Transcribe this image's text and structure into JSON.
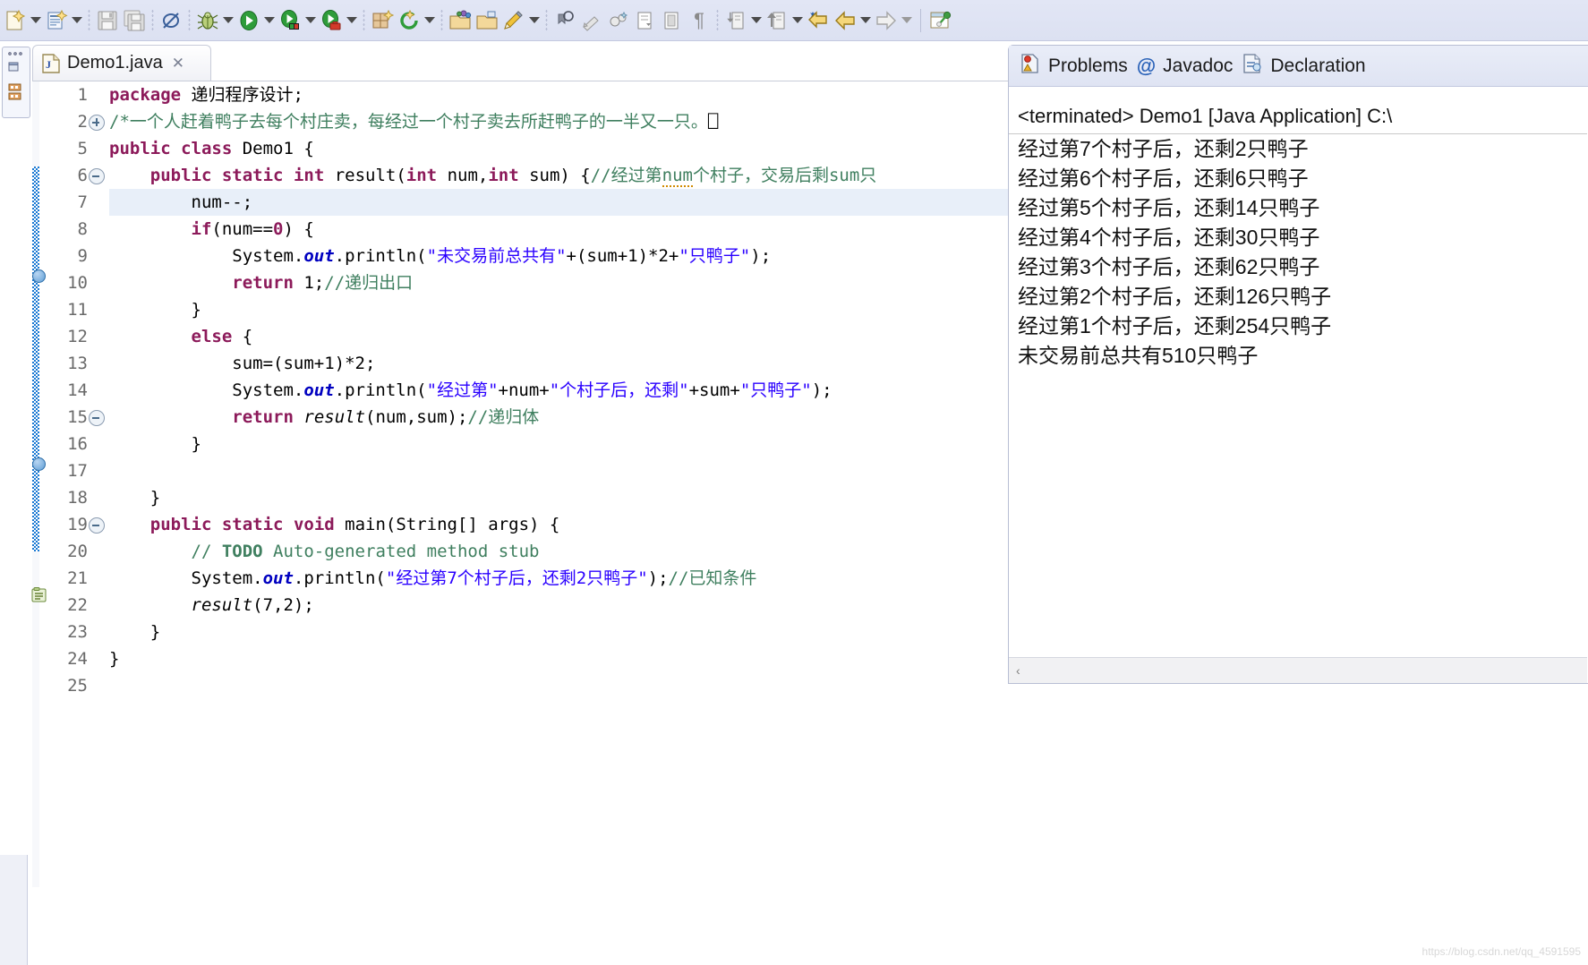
{
  "toolbar": {
    "groups": [
      {
        "name": "new-wizard",
        "icons": [
          "new-file-icon"
        ],
        "has_arrow": true
      },
      {
        "name": "new-java-class",
        "icons": [
          "new-java-class-icon"
        ],
        "has_arrow": true
      },
      {
        "name": "save-group",
        "icons": [
          "save-icon",
          "save-all-icon"
        ],
        "has_arrow": false
      },
      {
        "name": "toggle-mark-occurrences",
        "icons": [
          "mark-occurrences-icon"
        ],
        "has_arrow": false
      },
      {
        "name": "debug",
        "icons": [
          "debug-bug-icon"
        ],
        "has_arrow": true
      },
      {
        "name": "run",
        "icons": [
          "run-play-icon"
        ],
        "has_arrow": true
      },
      {
        "name": "coverage",
        "icons": [
          "coverage-icon"
        ],
        "has_arrow": true
      },
      {
        "name": "external-tools",
        "icons": [
          "external-tools-icon"
        ],
        "has_arrow": true
      },
      {
        "name": "new-package",
        "icons": [
          "new-package-icon"
        ],
        "has_arrow": false
      },
      {
        "name": "refresh",
        "icons": [
          "refresh-icon"
        ],
        "has_arrow": true
      },
      {
        "name": "open-type",
        "icons": [
          "open-type-icon",
          "open-task-icon"
        ],
        "has_arrow": false
      },
      {
        "name": "search",
        "icons": [
          "search-pencil-icon"
        ],
        "has_arrow": true
      },
      {
        "name": "annotation-nav",
        "icons": [
          "next-annotation-icon",
          "prev-annotation-icon",
          "bookmark-icon"
        ],
        "has_arrow": false
      },
      {
        "name": "editor-utils",
        "icons": [
          "block-selection-icon",
          "show-whitespace-icon",
          "pilcrow-icon"
        ],
        "has_arrow": false
      },
      {
        "name": "step-into",
        "icons": [
          "step-into-icon"
        ],
        "has_arrow": true
      },
      {
        "name": "step-return",
        "icons": [
          "step-return-icon"
        ],
        "has_arrow": true
      },
      {
        "name": "back-history",
        "icons": [
          "back-arrow-yellow-icon",
          "back-arrow-icon"
        ],
        "has_arrow": true
      },
      {
        "name": "forward-history",
        "icons": [
          "forward-arrow-icon"
        ],
        "has_arrow": true
      },
      {
        "name": "pin-editor",
        "icons": [
          "pin-editor-icon"
        ],
        "has_arrow": false
      }
    ]
  },
  "editor": {
    "tab": {
      "label": "Demo1.java",
      "icon": "java-file-icon",
      "close": "✕"
    },
    "line_numbers": [
      "1",
      "2",
      "5",
      "6",
      "7",
      "8",
      "9",
      "10",
      "11",
      "12",
      "13",
      "14",
      "15",
      "16",
      "17",
      "18",
      "19",
      "20",
      "21",
      "22",
      "23",
      "24",
      "25"
    ],
    "current_line": 7,
    "code_lines": [
      {
        "n": "1",
        "html": "<span class=\"kw\">package</span> 递归程序设计;"
      },
      {
        "n": "2",
        "html": "<span class=\"cmt\">/*一个人赶着鸭子去每个村庄卖，每经过一个村子卖去所赶鸭子的一半又一只。</span>⎕"
      },
      {
        "n": "5",
        "html": "<span class=\"kw\">public</span> <span class=\"kw\">class</span> Demo1 {"
      },
      {
        "n": "6",
        "html": "    <span class=\"kw\">public</span> <span class=\"kw\">static</span> <span class=\"kw\">int</span> result(<span class=\"kw\">int</span> num,<span class=\"kw\">int</span> sum) {<span class=\"cmt\">//经过第<span class=\"underln\">num</span>个村子，交易后剩sum只</span>"
      },
      {
        "n": "7",
        "html": "        num--;"
      },
      {
        "n": "8",
        "html": "        <span class=\"kw\">if</span>(num==<span class=\"kw\">0</span>) {"
      },
      {
        "n": "9",
        "html": "            System.<span class=\"sfield\">out</span>.println(<span class=\"str\">\"未交易前总共有\"</span>+(sum+1)*2+<span class=\"str\">\"只鸭子\"</span>);"
      },
      {
        "n": "10",
        "html": "            <span class=\"kw\">return</span> 1;<span class=\"cmt\">//递归出口</span>"
      },
      {
        "n": "11",
        "html": "        }"
      },
      {
        "n": "12",
        "html": "        <span class=\"kw\">else</span> {"
      },
      {
        "n": "13",
        "html": "            sum=(sum+1)*2;"
      },
      {
        "n": "14",
        "html": "            System.<span class=\"sfield\">out</span>.println(<span class=\"str\">\"经过第\"</span>+num+<span class=\"str\">\"个村子后，还剩\"</span>+sum+<span class=\"str\">\"只鸭子\"</span>);"
      },
      {
        "n": "15",
        "html": "            <span class=\"kw\">return</span> <span class=\"mth\">result</span>(num,sum);<span class=\"cmt\">//递归体</span>"
      },
      {
        "n": "16",
        "html": "        }"
      },
      {
        "n": "17",
        "html": ""
      },
      {
        "n": "18",
        "html": "    }"
      },
      {
        "n": "19",
        "html": "    <span class=\"kw\">public</span> <span class=\"kw\">static</span> <span class=\"kw\">void</span> main(String[] args) {"
      },
      {
        "n": "20",
        "html": "        <span class=\"cmt\">// </span><span class=\"todo-w\">TODO</span><span class=\"cmt\"> Auto-generated method stub</span>"
      },
      {
        "n": "21",
        "html": "        System.<span class=\"sfield\">out</span>.println(<span class=\"str\">\"经过第7个村子后，还剩2只鸭子\"</span>);<span class=\"cmt\">//已知条件</span>"
      },
      {
        "n": "22",
        "html": "        <span class=\"mth\">result</span>(7,2);"
      },
      {
        "n": "23",
        "html": "    }"
      },
      {
        "n": "24",
        "html": "}"
      },
      {
        "n": "25",
        "html": ""
      }
    ]
  },
  "right_view": {
    "tabs": [
      {
        "label": "Problems",
        "icon": "problems-icon"
      },
      {
        "label": "Javadoc",
        "icon": "at-icon"
      },
      {
        "label": "Declaration",
        "icon": "declaration-icon"
      }
    ],
    "console": {
      "terminated_line": "<terminated> Demo1 [Java Application] C:\\",
      "output": [
        "经过第7个村子后，还剩2只鸭子",
        "经过第6个村子后，还剩6只鸭子",
        "经过第5个村子后，还剩14只鸭子",
        "经过第4个村子后，还剩30只鸭子",
        "经过第3个村子后，还剩62只鸭子",
        "经过第2个村子后，还剩126只鸭子",
        "经过第1个村子后，还剩254只鸭子",
        "未交易前总共有510只鸭子"
      ],
      "scroll_left_arrow": "‹"
    }
  },
  "watermark": "https://blog.csdn.net/qq_4591595",
  "colors": {
    "toolbar_bg": "#e2e6f5",
    "keyword": "#8c1a5a",
    "string": "#2a00ff",
    "comment": "#3f7f5f",
    "current_line": "#e8eff9",
    "changebar": "#1978d2"
  }
}
